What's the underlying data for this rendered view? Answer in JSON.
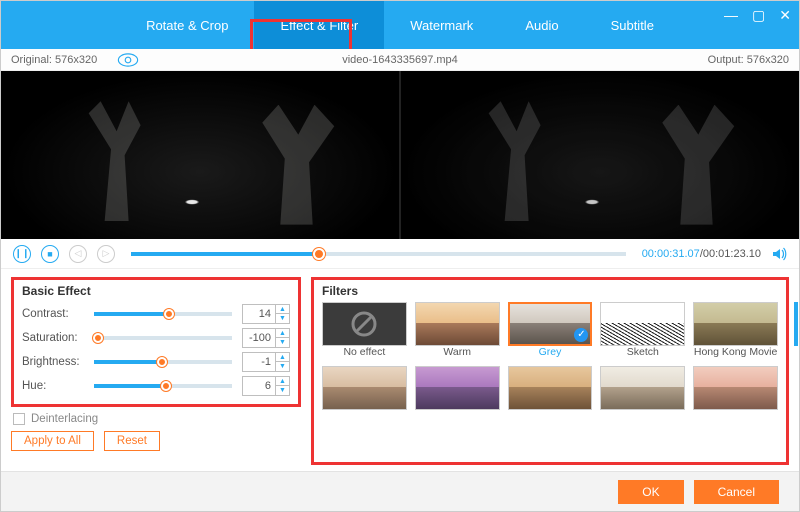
{
  "window": {
    "app": ""
  },
  "tabs": [
    "Rotate & Crop",
    "Effect & Filter",
    "Watermark",
    "Audio",
    "Subtitle"
  ],
  "active_tab": 1,
  "infobar": {
    "original_label": "Original:",
    "original_dims": "576x320",
    "filename": "video-1643335697.mp4",
    "output_label": "Output:",
    "output_dims": "576x320"
  },
  "playback": {
    "current": "00:00:31.07",
    "total": "00:01:23.10",
    "progress_pct": 38
  },
  "basic": {
    "title": "Basic Effect",
    "params": [
      {
        "label": "Contrast:",
        "value": 14,
        "pct": 54
      },
      {
        "label": "Saturation:",
        "value": -100,
        "pct": 3
      },
      {
        "label": "Brightness:",
        "value": -1,
        "pct": 49
      },
      {
        "label": "Hue:",
        "value": 6,
        "pct": 52
      }
    ],
    "deinterlacing": "Deinterlacing",
    "apply_all": "Apply to All",
    "reset": "Reset"
  },
  "filters": {
    "title": "Filters",
    "items": [
      {
        "name": "No effect",
        "kind": "none"
      },
      {
        "name": "Warm",
        "kind": "warm"
      },
      {
        "name": "Grey",
        "kind": "grey",
        "selected": true
      },
      {
        "name": "Sketch",
        "kind": "sketch"
      },
      {
        "name": "Hong Kong Movie",
        "kind": "hk"
      },
      {
        "name": "",
        "kind": "haze"
      },
      {
        "name": "",
        "kind": "violet"
      },
      {
        "name": "",
        "kind": "sepia"
      },
      {
        "name": "",
        "kind": "bleach"
      },
      {
        "name": "",
        "kind": "pink"
      }
    ]
  },
  "footer": {
    "ok": "OK",
    "cancel": "Cancel"
  }
}
